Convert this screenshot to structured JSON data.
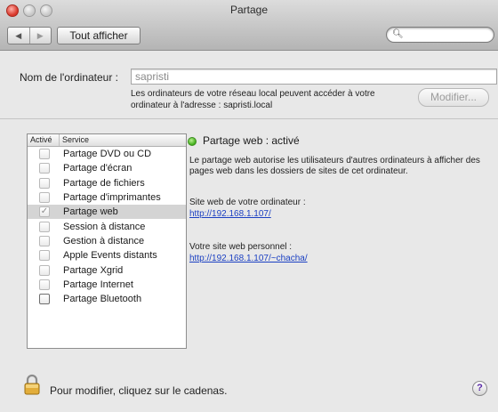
{
  "window": {
    "title": "Partage"
  },
  "toolbar": {
    "back_icon": "◀",
    "forward_icon": "▶",
    "show_all_label": "Tout afficher",
    "search_icon": "magnifying-glass",
    "search_value": ""
  },
  "computer": {
    "name_label": "Nom de l'ordinateur :",
    "name_value": "sapristi",
    "address_text": "Les ordinateurs de votre réseau local peuvent accéder à votre ordinateur à l'adresse : sapristi.local",
    "modify_button": "Modifier..."
  },
  "services": {
    "header_enabled": "Activé",
    "header_service": "Service",
    "items": [
      {
        "label": "Partage DVD ou CD",
        "checked": false,
        "selected": false
      },
      {
        "label": "Partage d'écran",
        "checked": false,
        "selected": false
      },
      {
        "label": "Partage de fichiers",
        "checked": false,
        "selected": false
      },
      {
        "label": "Partage d'imprimantes",
        "checked": false,
        "selected": false
      },
      {
        "label": "Partage web",
        "checked": true,
        "selected": true
      },
      {
        "label": "Session à distance",
        "checked": false,
        "selected": false
      },
      {
        "label": "Gestion à distance",
        "checked": false,
        "selected": false
      },
      {
        "label": "Apple Events distants",
        "checked": false,
        "selected": false
      },
      {
        "label": "Partage Xgrid",
        "checked": false,
        "selected": false
      },
      {
        "label": "Partage Internet",
        "checked": false,
        "selected": false
      },
      {
        "label": "Partage Bluetooth",
        "checked": false,
        "selected": false
      }
    ]
  },
  "detail": {
    "status": "Partage web : activé",
    "status_color": "#3fae19",
    "description": "Le partage web autorise les utilisateurs d'autres ordinateurs à afficher des pages web dans les dossiers de sites de cet ordinateur.",
    "computer_site_label": "Site web de votre ordinateur :",
    "computer_site_link": "http://192.168.1.107/",
    "personal_site_label": "Votre site web personnel :",
    "personal_site_link": "http://192.168.1.107/~chacha/"
  },
  "footer": {
    "lock_message": "Pour modifier, cliquez sur le cadenas.",
    "help_label": "?"
  }
}
